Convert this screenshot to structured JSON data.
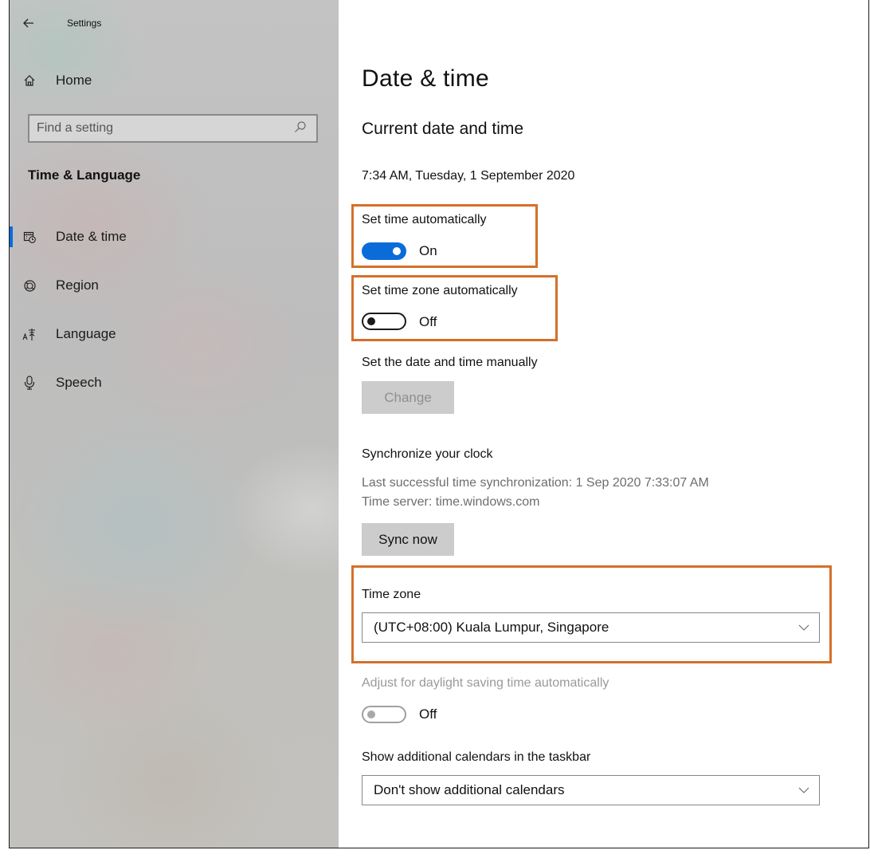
{
  "window": {
    "title": "Settings"
  },
  "nav": {
    "home_label": "Home",
    "search_placeholder": "Find a setting",
    "section_title": "Time & Language",
    "items": [
      {
        "label": "Date & time",
        "icon": "calendar-clock-icon",
        "selected": true
      },
      {
        "label": "Region",
        "icon": "globe-icon",
        "selected": false
      },
      {
        "label": "Language",
        "icon": "language-icon",
        "selected": false
      },
      {
        "label": "Speech",
        "icon": "microphone-icon",
        "selected": false
      }
    ]
  },
  "page": {
    "title": "Date & time",
    "subtitle": "Current date and time",
    "current_datetime": "7:34 AM, Tuesday, 1 September 2020",
    "auto_time": {
      "label": "Set time automatically",
      "state": "On",
      "on": true
    },
    "auto_timezone": {
      "label": "Set time zone automatically",
      "state": "Off",
      "on": false
    },
    "manual": {
      "label": "Set the date and time manually",
      "button": "Change",
      "enabled": false
    },
    "sync": {
      "heading": "Synchronize your clock",
      "last_sync": "Last successful time synchronization: 1 Sep 2020 7:33:07 AM",
      "server": "Time server: time.windows.com",
      "button": "Sync now"
    },
    "timezone": {
      "label": "Time zone",
      "value": "(UTC+08:00) Kuala Lumpur, Singapore"
    },
    "dst": {
      "label": "Adjust for daylight saving time automatically",
      "state": "Off",
      "enabled": false
    },
    "calendars": {
      "label": "Show additional calendars in the taskbar",
      "value": "Don't show additional calendars"
    }
  },
  "colors": {
    "accent": "#0a6cd9",
    "highlight": "#d4702a",
    "button_bg": "#cccccc"
  }
}
